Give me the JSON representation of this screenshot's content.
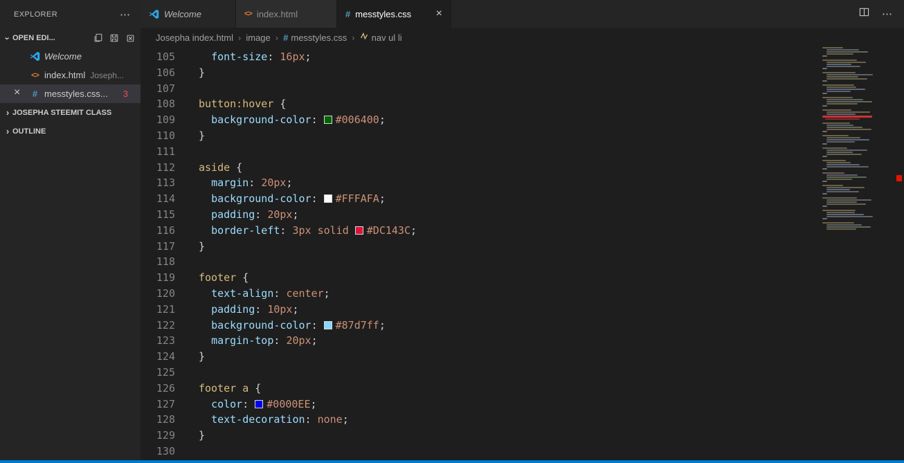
{
  "icons": {
    "more": "⋯",
    "close": "×",
    "chevron": "›",
    "separator": "›",
    "css_glyph": "#",
    "html_glyph": "<>"
  },
  "sidebar": {
    "title": "EXPLORER",
    "open_editors": {
      "label": "OPEN EDI...",
      "items": [
        {
          "label": "Welcome"
        },
        {
          "label": "index.html",
          "description": "Joseph..."
        },
        {
          "label": "messtyles.css...",
          "error_count": "3"
        }
      ]
    },
    "sections": [
      {
        "label": "JOSEPHA STEEMIT CLASS"
      },
      {
        "label": "OUTLINE"
      }
    ]
  },
  "tabs": [
    {
      "label": "Welcome"
    },
    {
      "label": "index.html"
    },
    {
      "label": "messtyles.css"
    }
  ],
  "breadcrumb": {
    "items": [
      {
        "label": "Josepha index.html"
      },
      {
        "label": "image"
      },
      {
        "label": "messtyles.css"
      },
      {
        "label": "nav ul li"
      }
    ]
  },
  "editor": {
    "language": "css",
    "first_line": 105,
    "last_line": 130,
    "lines": [
      {
        "n": 105,
        "t": [
          [
            "pn",
            "  "
          ],
          [
            "prop",
            "font-size"
          ],
          [
            "pn",
            ": "
          ],
          [
            "val",
            "16px"
          ],
          [
            "pn",
            ";"
          ]
        ]
      },
      {
        "n": 106,
        "t": [
          [
            "pn",
            "}"
          ]
        ]
      },
      {
        "n": 107,
        "t": []
      },
      {
        "n": 108,
        "t": [
          [
            "sel",
            "button:hover"
          ],
          [
            "pn",
            " {"
          ]
        ]
      },
      {
        "n": 109,
        "t": [
          [
            "pn",
            "  "
          ],
          [
            "prop",
            "background-color"
          ],
          [
            "pn",
            ": "
          ],
          [
            "swatch",
            "#006400"
          ],
          [
            "val",
            "#006400"
          ],
          [
            "pn",
            ";"
          ]
        ]
      },
      {
        "n": 110,
        "t": [
          [
            "pn",
            "}"
          ]
        ]
      },
      {
        "n": 111,
        "t": []
      },
      {
        "n": 112,
        "t": [
          [
            "sel",
            "aside"
          ],
          [
            "pn",
            " {"
          ]
        ]
      },
      {
        "n": 113,
        "t": [
          [
            "pn",
            "  "
          ],
          [
            "prop",
            "margin"
          ],
          [
            "pn",
            ": "
          ],
          [
            "val",
            "20px"
          ],
          [
            "pn",
            ";"
          ]
        ]
      },
      {
        "n": 114,
        "t": [
          [
            "pn",
            "  "
          ],
          [
            "prop",
            "background-color"
          ],
          [
            "pn",
            ": "
          ],
          [
            "swatch",
            "#FFFAFA"
          ],
          [
            "val",
            "#FFFAFA"
          ],
          [
            "pn",
            ";"
          ]
        ]
      },
      {
        "n": 115,
        "t": [
          [
            "pn",
            "  "
          ],
          [
            "prop",
            "padding"
          ],
          [
            "pn",
            ": "
          ],
          [
            "val",
            "20px"
          ],
          [
            "pn",
            ";"
          ]
        ]
      },
      {
        "n": 116,
        "t": [
          [
            "pn",
            "  "
          ],
          [
            "prop",
            "border-left"
          ],
          [
            "pn",
            ": "
          ],
          [
            "val",
            "3px solid "
          ],
          [
            "swatch",
            "#DC143C"
          ],
          [
            "val",
            "#DC143C"
          ],
          [
            "pn",
            ";"
          ]
        ]
      },
      {
        "n": 117,
        "t": [
          [
            "pn",
            "}"
          ]
        ]
      },
      {
        "n": 118,
        "t": []
      },
      {
        "n": 119,
        "t": [
          [
            "sel",
            "footer"
          ],
          [
            "pn",
            " {"
          ]
        ]
      },
      {
        "n": 120,
        "t": [
          [
            "pn",
            "  "
          ],
          [
            "prop",
            "text-align"
          ],
          [
            "pn",
            ": "
          ],
          [
            "val",
            "center"
          ],
          [
            "pn",
            ";"
          ]
        ]
      },
      {
        "n": 121,
        "t": [
          [
            "pn",
            "  "
          ],
          [
            "prop",
            "padding"
          ],
          [
            "pn",
            ": "
          ],
          [
            "val",
            "10px"
          ],
          [
            "pn",
            ";"
          ]
        ]
      },
      {
        "n": 122,
        "t": [
          [
            "pn",
            "  "
          ],
          [
            "prop",
            "background-color"
          ],
          [
            "pn",
            ": "
          ],
          [
            "swatch",
            "#87d7ff"
          ],
          [
            "val",
            "#87d7ff"
          ],
          [
            "pn",
            ";"
          ]
        ]
      },
      {
        "n": 123,
        "t": [
          [
            "pn",
            "  "
          ],
          [
            "prop",
            "margin-top"
          ],
          [
            "pn",
            ": "
          ],
          [
            "val",
            "20px"
          ],
          [
            "pn",
            ";"
          ]
        ]
      },
      {
        "n": 124,
        "t": [
          [
            "pn",
            "}"
          ]
        ]
      },
      {
        "n": 125,
        "t": []
      },
      {
        "n": 126,
        "t": [
          [
            "sel",
            "footer a"
          ],
          [
            "pn",
            " {"
          ]
        ]
      },
      {
        "n": 127,
        "t": [
          [
            "pn",
            "  "
          ],
          [
            "prop",
            "color"
          ],
          [
            "pn",
            ": "
          ],
          [
            "swatch",
            "#0000EE"
          ],
          [
            "val",
            "#0000EE"
          ],
          [
            "pn",
            ";"
          ]
        ]
      },
      {
        "n": 128,
        "t": [
          [
            "pn",
            "  "
          ],
          [
            "prop",
            "text-decoration"
          ],
          [
            "pn",
            ": "
          ],
          [
            "val",
            "none"
          ],
          [
            "pn",
            ";"
          ]
        ]
      },
      {
        "n": 129,
        "t": [
          [
            "pn",
            "}"
          ]
        ]
      },
      {
        "n": 130,
        "t": []
      }
    ]
  },
  "colors": {
    "status_accent": "#007acc",
    "error": "#f14c4c",
    "swatches": [
      "#006400",
      "#FFFAFA",
      "#DC143C",
      "#87d7ff",
      "#0000EE"
    ]
  }
}
